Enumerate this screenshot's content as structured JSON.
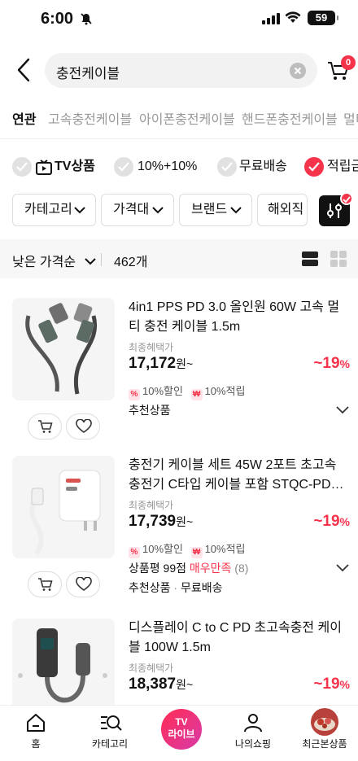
{
  "status_bar": {
    "time": "6:00",
    "battery": "59"
  },
  "search": {
    "query": "충전케이블"
  },
  "cart": {
    "badge": "0"
  },
  "related": {
    "label": "연관",
    "keywords": [
      "고속충전케이블",
      "아이폰충전케이블",
      "핸드폰충전케이블",
      "멀티"
    ]
  },
  "checks": [
    {
      "label": "TV상품",
      "checked": false,
      "icon": "tv-icon"
    },
    {
      "label": "10%+10%",
      "checked": false
    },
    {
      "label": "무료배송",
      "checked": false
    },
    {
      "label": "적립금",
      "checked": true
    }
  ],
  "chips": [
    "카테고리",
    "가격대",
    "브랜드",
    "해외직"
  ],
  "sort": {
    "label": "낮은 가격순",
    "count": "462개"
  },
  "products": [
    {
      "title": "4in1 PPS PD 3.0 올인원 60W 고속 멀티 충전 케이블 1.5m",
      "benefit": "최종혜택가",
      "price": "17,172",
      "price_unit": "원~",
      "discount": "~19",
      "discount_unit": "%",
      "tag1": "10%할인",
      "tag2": "10%적립",
      "rating_prefix": "",
      "rating_word": "",
      "rating_count": "",
      "extra1": "추천상품",
      "extra2": ""
    },
    {
      "title": "충전기 케이블 세트 45W 2포트 초고속 충전기 C타입 케이블 포함 STQC-PD…",
      "benefit": "최종혜택가",
      "price": "17,739",
      "price_unit": "원~",
      "discount": "~19",
      "discount_unit": "%",
      "tag1": "10%할인",
      "tag2": "10%적립",
      "rating_prefix": "상품평 99점",
      "rating_word": "매우만족",
      "rating_count": "(8)",
      "extra1": "추천상품",
      "extra2": "무료배송"
    },
    {
      "title": "디스플레이 C to C PD 초고속충전 케이블 100W 1.5m",
      "benefit": "최종혜택가",
      "price": "18,387",
      "price_unit": "원~",
      "discount": "~19",
      "discount_unit": "%"
    }
  ],
  "nav": [
    {
      "label": "홈",
      "icon": "home-icon"
    },
    {
      "label": "카테고리",
      "icon": "category-search-icon"
    },
    {
      "label": "TV\n라이브",
      "icon": "tv-live-icon"
    },
    {
      "label": "나의쇼핑",
      "icon": "person-icon"
    },
    {
      "label": "최근본상품",
      "icon": "recent-product-thumbnail"
    }
  ],
  "tv_live": {
    "line1": "TV",
    "line2": "라이브"
  },
  "colors": {
    "accent": "#f5334b",
    "text": "#111111",
    "muted": "#999999"
  }
}
